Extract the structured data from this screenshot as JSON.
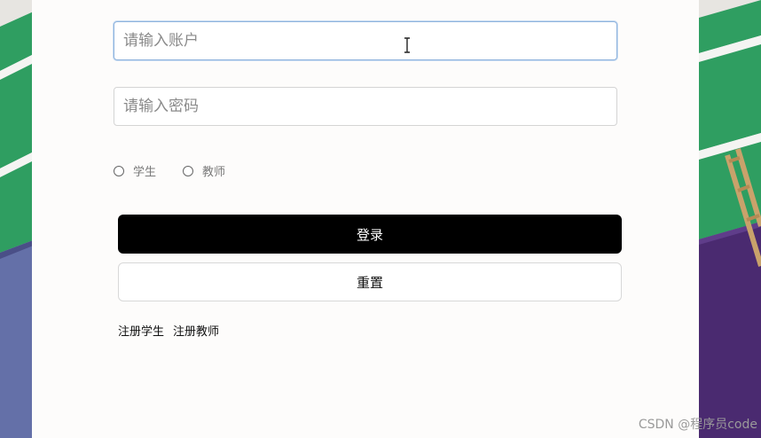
{
  "form": {
    "account_placeholder": "请输入账户",
    "password_placeholder": "请输入密码",
    "roles": [
      "学生",
      "教师"
    ],
    "login_label": "登录",
    "reset_label": "重置",
    "register_student": "注册学生",
    "register_teacher": "注册教师"
  },
  "watermark": "CSDN @程序员code",
  "colors": {
    "login_button": "#000000",
    "focus_border": "#8fb3dd",
    "bg_green": "#2f9e61",
    "bg_purple": "#4a2a70",
    "bg_blue": "#6470a8"
  }
}
